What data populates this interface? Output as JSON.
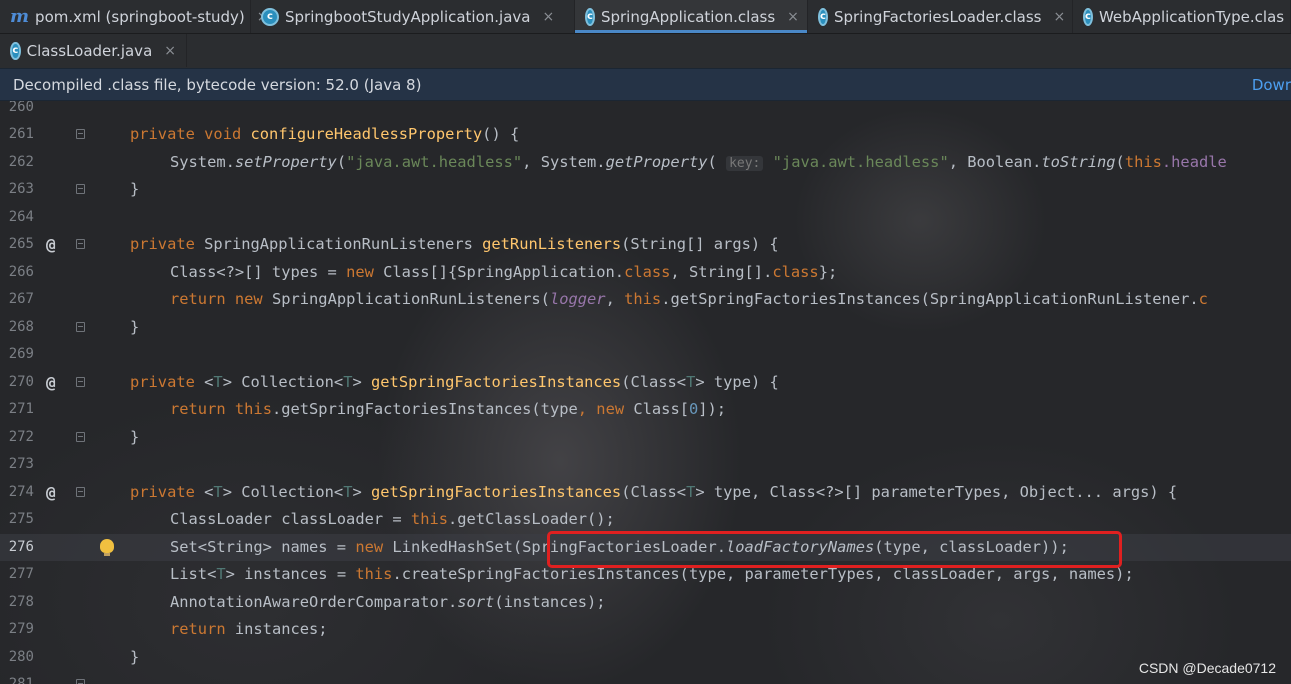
{
  "tabs_row1": [
    {
      "icon": "maven-icon",
      "label": "pom.xml (springboot-study)",
      "close": "×",
      "active": false
    },
    {
      "icon": "class-icon",
      "label": "SpringbootStudyApplication.java",
      "close": "×",
      "active": false
    },
    {
      "icon": "class-icon",
      "label": "SpringApplication.class",
      "close": "×",
      "active": true
    },
    {
      "icon": "class-icon",
      "label": "SpringFactoriesLoader.class",
      "close": "×",
      "active": false
    },
    {
      "icon": "class-icon",
      "label": "WebApplicationType.clas",
      "close": "",
      "active": false
    }
  ],
  "tabs_row2": [
    {
      "icon": "class-icon",
      "label": "ClassLoader.java",
      "close": "×",
      "active": false
    }
  ],
  "banner": {
    "text": "Decompiled .class file, bytecode version: 52.0 (Java 8)",
    "link": "Dowr"
  },
  "editor": {
    "current_line": "276",
    "lines": [
      {
        "n": "260"
      },
      {
        "n": "261"
      },
      {
        "n": "262"
      },
      {
        "n": "263"
      },
      {
        "n": "264"
      },
      {
        "n": "265"
      },
      {
        "n": "266"
      },
      {
        "n": "267"
      },
      {
        "n": "268"
      },
      {
        "n": "269"
      },
      {
        "n": "270"
      },
      {
        "n": "271"
      },
      {
        "n": "272"
      },
      {
        "n": "273"
      },
      {
        "n": "274"
      },
      {
        "n": "275"
      },
      {
        "n": "276"
      },
      {
        "n": "277"
      },
      {
        "n": "278"
      },
      {
        "n": "279"
      },
      {
        "n": "280"
      },
      {
        "n": "281"
      }
    ],
    "override_marker": "@",
    "param_hint": "key:",
    "code": {
      "l261": {
        "kw1": "private",
        "kw2": "void",
        "fn": "configureHeadlessProperty",
        "rest": "() {"
      },
      "l262": {
        "a": "System.",
        "m1": "setProperty",
        "b": "(",
        "s1": "\"java.awt.headless\"",
        "c": ", System.",
        "m2": "getProperty",
        "d": "(",
        "s2": "\"java.awt.headless\"",
        "e": ", Boolean.",
        "m3": "toString",
        "f": "(",
        "kw": "this",
        "g": ".headle"
      },
      "l263": "}",
      "l265": {
        "kw": "private",
        "a": " SpringApplicationRunListeners ",
        "fn": "getRunListeners",
        "b": "(String[] args) {"
      },
      "l266": {
        "a": "Class<?>[] types = ",
        "kw1": "new",
        "b": " Class[]{SpringApplication.",
        "kw2": "class",
        "c": ", String[].",
        "kw3": "class",
        "d": "};"
      },
      "l267": {
        "kw1": "return",
        "kw2": "new",
        "a": " SpringApplicationRunListeners(",
        "fld": "logger",
        "b": ", ",
        "kw3": "this",
        "c": ".getSpringFactoriesInstances(SpringApplicationRunListener.",
        "kw4": "c"
      },
      "l268": "}",
      "l270": {
        "kw": "private",
        "t1": "T",
        "a": " Collection<",
        "t2": "T",
        "fn": "getSpringFactoriesInstances",
        "b": "(Class<",
        "t3": "T",
        "c": "> type) {"
      },
      "l271": {
        "kw1": "return",
        "kw2": "this",
        "a": ".getSpringFactoriesInstances(type",
        "kw3": "new",
        "b": " Class[",
        "num": "0",
        "c": "]);"
      },
      "l272": "}",
      "l274": {
        "kw": "private",
        "t1": "T",
        "a": " Collection<",
        "t2": "T",
        "fn": "getSpringFactoriesInstances",
        "b": "(Class<",
        "t3": "T",
        "c": "> type, Class<?>[] parameterTypes, Object... args) {"
      },
      "l275": {
        "a": "ClassLoader classLoader = ",
        "kw": "this",
        "b": ".getClassLoader();"
      },
      "l276": {
        "a": "Set<String> names = ",
        "kw": "new",
        "b": " LinkedHashSet(SpringFactoriesLoader.",
        "m": "loadFactoryNames",
        "c": "(type, classLoader));"
      },
      "l277": {
        "a": "List<",
        "t": "T",
        "b": "> instances = ",
        "kw": "this",
        "c": ".createSpringFactoriesInstances(type, parameterTypes, classLoader, args, names);"
      },
      "l278": {
        "a": "AnnotationAwareOrderComparator.",
        "m": "sort",
        "b": "(instances);"
      },
      "l279": {
        "kw": "return",
        "a": " instances;"
      },
      "l280": "}"
    }
  },
  "watermark": "CSDN @Decade0712",
  "colors": {
    "accent": "#4a88c7",
    "banner_bg": "#253346",
    "highlight_box": "#e02020"
  }
}
